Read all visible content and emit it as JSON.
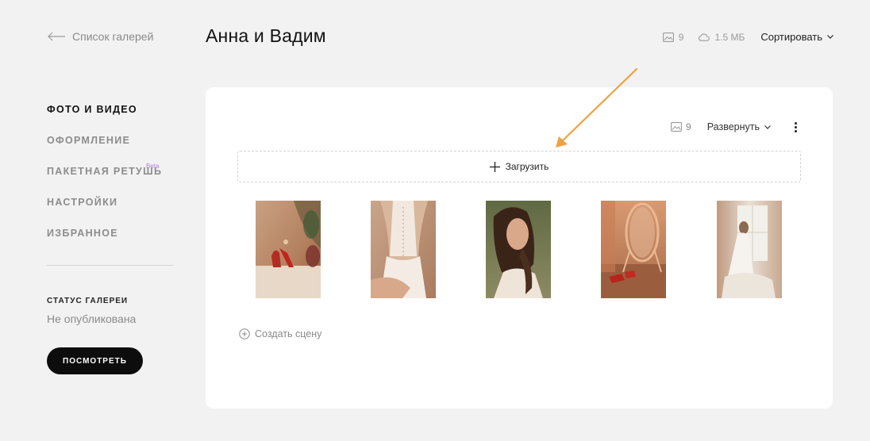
{
  "header": {
    "back_label": "Список галерей",
    "title": "Анна и Вадим",
    "photo_count": "9",
    "storage": "1.5 МБ",
    "sort_label": "Сортировать"
  },
  "sidebar": {
    "items": [
      {
        "label": "Фото и видео",
        "active": true
      },
      {
        "label": "Оформление"
      },
      {
        "label": "Пакетная ретушь",
        "badge": "Beta"
      },
      {
        "label": "Настройки"
      },
      {
        "label": "Избранное"
      }
    ],
    "status_label": "СТАТУС ГАЛЕРЕИ",
    "status_value": "Не опубликована",
    "view_button": "ПОСМОТРЕТЬ"
  },
  "panel": {
    "photo_count": "9",
    "expand_label": "Развернуть",
    "upload_label": "Загрузить",
    "create_scene_label": "Создать сцену",
    "photos": [
      {
        "subject": "red-shoes-on-table"
      },
      {
        "subject": "dress-back-lacing"
      },
      {
        "subject": "bride-portrait"
      },
      {
        "subject": "shoes-and-mirror"
      },
      {
        "subject": "bride-at-window"
      }
    ]
  },
  "colors": {
    "background": "#f2f2f2",
    "panel": "#ffffff",
    "primary_button": "#0d0d0d",
    "beta_badge": "#b57bd6",
    "annotation_arrow": "#f0a040"
  }
}
